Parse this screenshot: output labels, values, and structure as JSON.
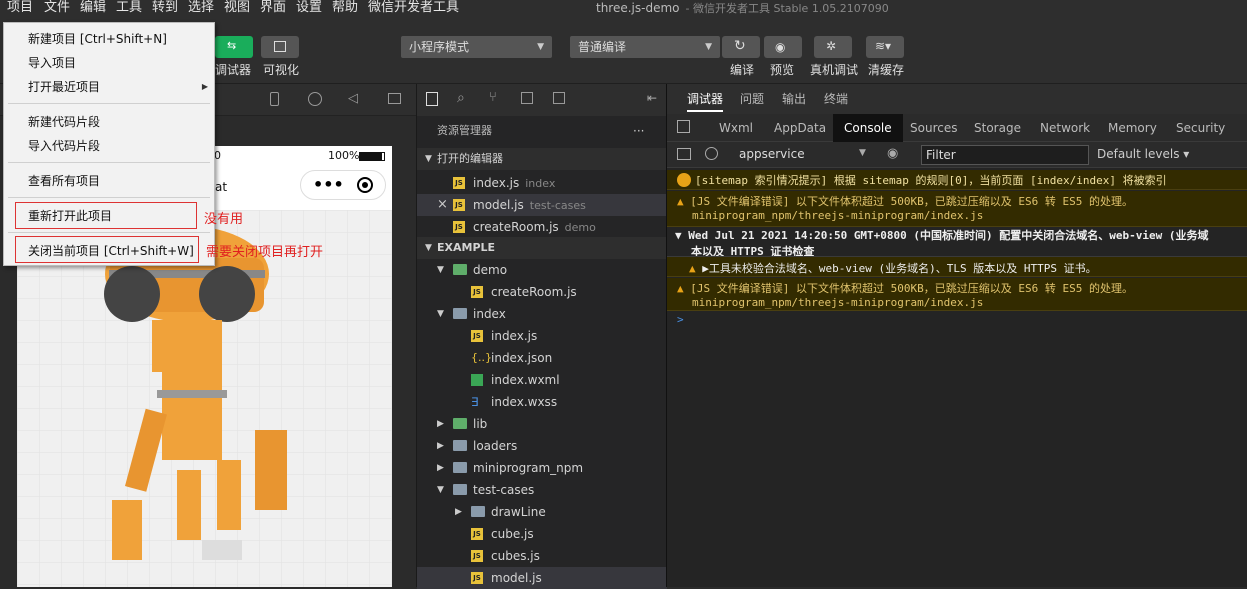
{
  "menubar": {
    "items": [
      "项目",
      "文件",
      "编辑",
      "工具",
      "转到",
      "选择",
      "视图",
      "界面",
      "设置",
      "帮助",
      "微信开发者工具"
    ],
    "window_title": "three.js-demo",
    "window_subtitle": "- 微信开发者工具 Stable 1.05.2107090"
  },
  "toolbar": {
    "debugger_label": "调试器",
    "visual_label": "可视化",
    "mode_select": "小程序模式",
    "compile_select": "普通编译",
    "actions": [
      "编译",
      "预览",
      "真机调试",
      "清缓存"
    ]
  },
  "dropdown": {
    "items": [
      {
        "label": "新建项目  [Ctrl+Shift+N]"
      },
      {
        "label": "导入项目"
      },
      {
        "label": "打开最近项目",
        "submenu_arrow": "▶"
      },
      {
        "label": "新建代码片段"
      },
      {
        "label": "导入代码片段"
      },
      {
        "label": "查看所有项目"
      },
      {
        "label": "重新打开此项目"
      },
      {
        "label": "关闭当前项目  [Ctrl+Shift+W]"
      }
    ]
  },
  "annotations": {
    "note1": "没有用",
    "note2": "需要关闭项目再打开"
  },
  "simulator": {
    "battery": "100%",
    "title_fragment": "at",
    "bg_time": "0"
  },
  "explorer": {
    "title": "资源管理器",
    "more": "···",
    "open_editors_header": "打开的编辑器",
    "open_editors": [
      {
        "name": "index.js",
        "desc": "index"
      },
      {
        "name": "model.js",
        "desc": "test-cases",
        "close": "×"
      },
      {
        "name": "createRoom.js",
        "desc": "demo"
      }
    ],
    "project_header": "EXAMPLE",
    "tree": [
      {
        "name": "demo",
        "type": "folder-open",
        "level": 1
      },
      {
        "name": "createRoom.js",
        "type": "js",
        "level": 2
      },
      {
        "name": "index",
        "type": "folder-open",
        "level": 1
      },
      {
        "name": "index.js",
        "type": "js",
        "level": 2
      },
      {
        "name": "index.json",
        "type": "json",
        "level": 2
      },
      {
        "name": "index.wxml",
        "type": "wxml",
        "level": 2
      },
      {
        "name": "index.wxss",
        "type": "wxss",
        "level": 2
      },
      {
        "name": "lib",
        "type": "folder",
        "level": 1
      },
      {
        "name": "loaders",
        "type": "folder",
        "level": 1
      },
      {
        "name": "miniprogram_npm",
        "type": "folder",
        "level": 1
      },
      {
        "name": "test-cases",
        "type": "folder-open",
        "level": 1
      },
      {
        "name": "drawLine",
        "type": "folder",
        "level": 2
      },
      {
        "name": "cube.js",
        "type": "js",
        "level": 2
      },
      {
        "name": "cubes.js",
        "type": "js",
        "level": 2
      },
      {
        "name": "model.js",
        "type": "js",
        "level": 2
      }
    ]
  },
  "devtools": {
    "top_tabs": [
      "调试器",
      "问题",
      "输出",
      "终端"
    ],
    "panel_tabs": [
      "Wxml",
      "AppData",
      "Console",
      "Sources",
      "Storage",
      "Network",
      "Memory",
      "Security"
    ],
    "active_panel": "Console",
    "context_select": "appservice",
    "filter_placeholder": "Filter",
    "levels": "Default levels",
    "messages": [
      "[sitemap 索引情况提示] 根据 sitemap 的规则[0]，当前页面 [index/index] 将被索引",
      "[JS 文件编译错误] 以下文件体积超过 500KB，已跳过压缩以及 ES6 转 ES5 的处理。",
      "miniprogram_npm/threejs-miniprogram/index.js",
      "Wed Jul 21 2021 14:20:50 GMT+0800 (中国标准时间) 配置中关闭合法域名、web-view (业务域",
      "本以及 HTTPS 证书检查",
      "▶工具未校验合法域名、web-view (业务域名)、TLS 版本以及 HTTPS 证书。",
      "[JS 文件编译错误] 以下文件体积超过 500KB，已跳过压缩以及 ES6 转 ES5 的处理。",
      "miniprogram_npm/threejs-miniprogram/index.js"
    ],
    "prompt": ">"
  },
  "colors": {
    "accent_green": "#1aad5b",
    "warning": "#e0c36d",
    "robot_orange": "#f0a23a"
  }
}
